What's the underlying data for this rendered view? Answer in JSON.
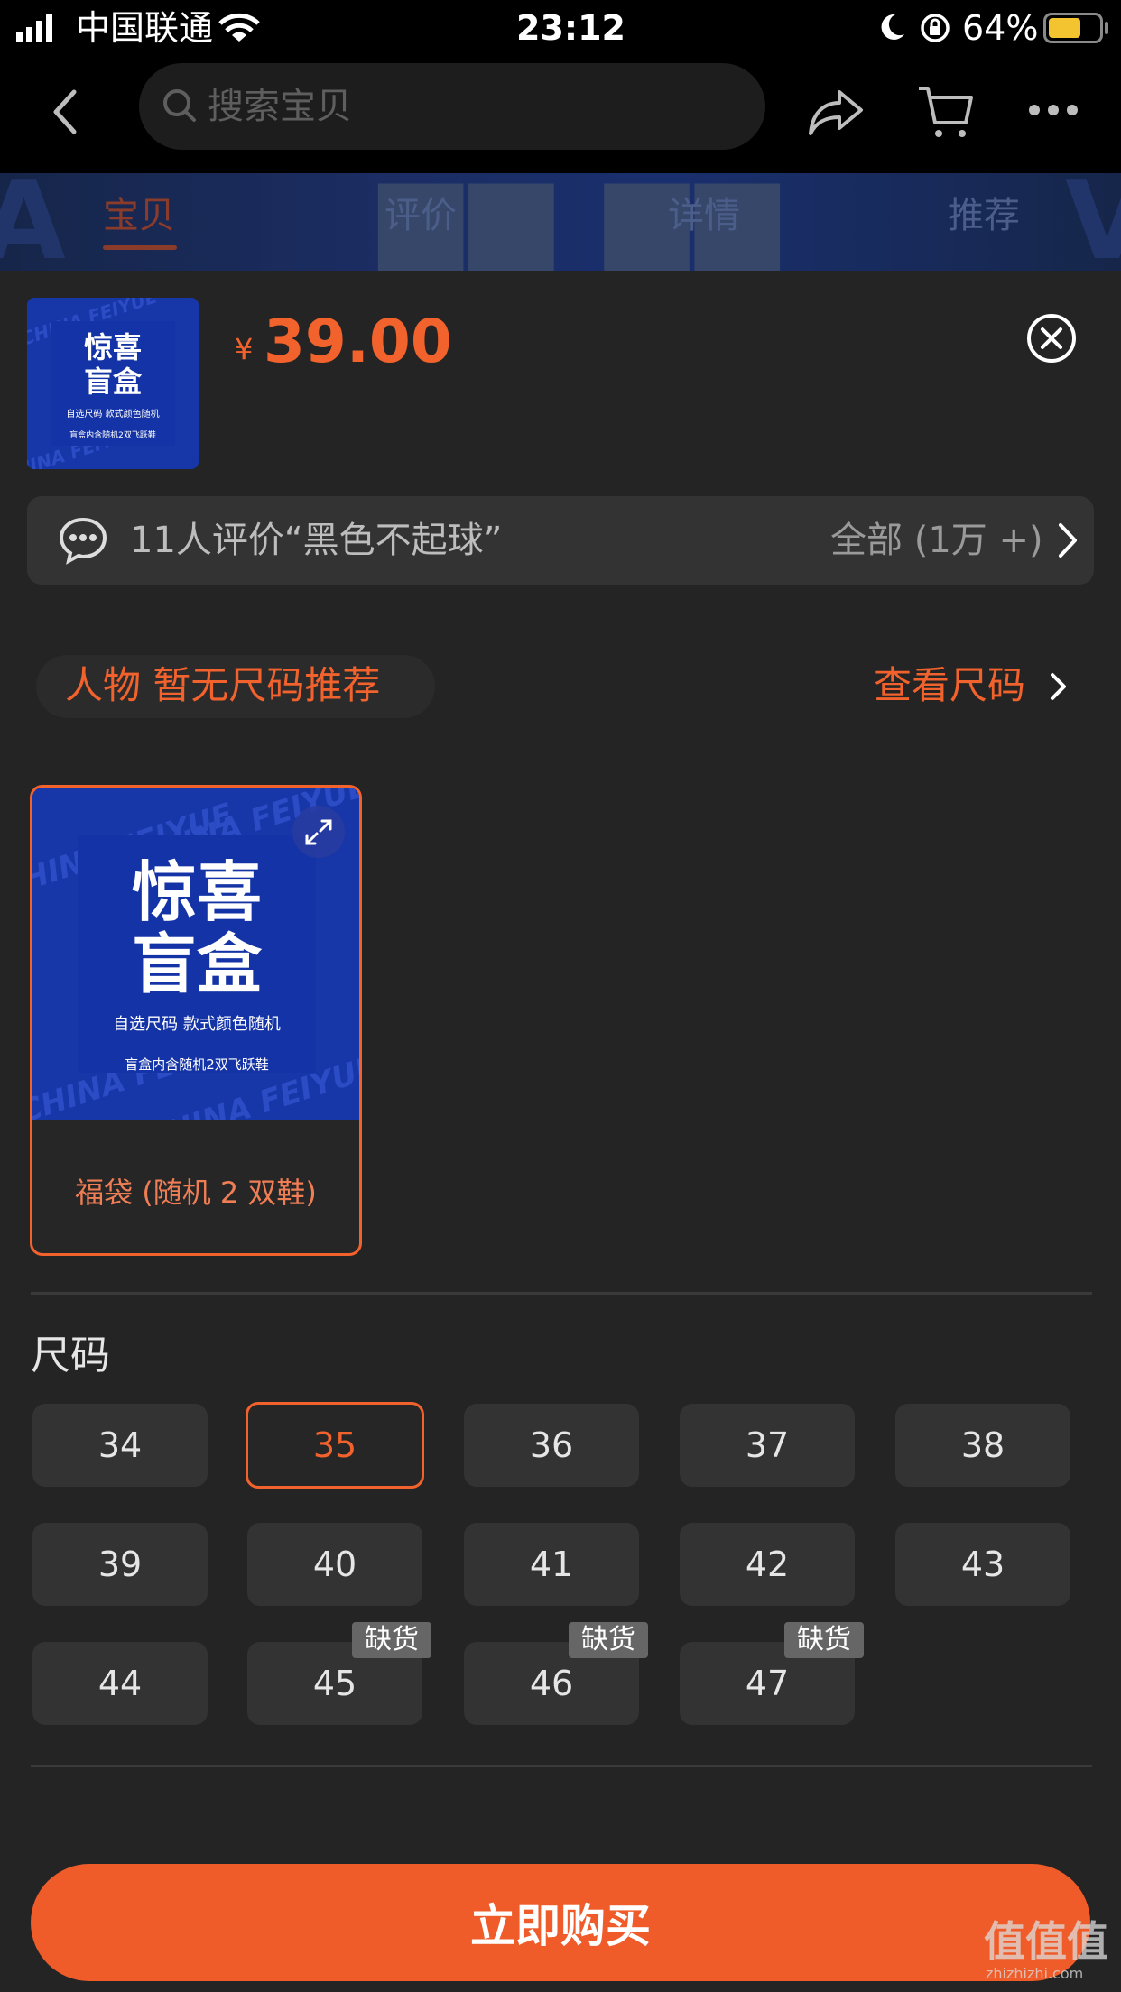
{
  "status_bar": {
    "carrier": "中国联通",
    "time": "23:12",
    "battery": "64%",
    "battery_level": 0.64,
    "icons": [
      "signal-icon",
      "wifi-icon",
      "moon-icon",
      "orientation-lock-icon",
      "battery-icon"
    ]
  },
  "nav": {
    "search_placeholder": "搜索宝贝",
    "icons": [
      "back-icon",
      "search-icon",
      "share-icon",
      "cart-icon",
      "more-icon"
    ]
  },
  "tabs": [
    {
      "label": "宝贝",
      "active": true
    },
    {
      "label": "评价",
      "active": false
    },
    {
      "label": "详情",
      "active": false
    },
    {
      "label": "推荐",
      "active": false
    }
  ],
  "product": {
    "currency": "¥",
    "price": "39.00",
    "art_title_line1": "惊喜",
    "art_title_line2": "盲盒",
    "art_subtitle": "自选尺码  款式颜色随机",
    "art_note": "盲盒内含随机2双飞跃鞋",
    "art_bg_text": "CHINA FEIYUE"
  },
  "review_bar": {
    "text": "11人评价“黑色不起球”",
    "all_label": "全部 (1万 +)"
  },
  "size_recommend": {
    "text": "人物 暂无尺码推荐",
    "link": "查看尺码"
  },
  "variant": {
    "label": "福袋 (随机 2 双鞋)",
    "selected": true
  },
  "sizes": {
    "title": "尺码",
    "items": [
      {
        "label": "34",
        "out_of_stock": false
      },
      {
        "label": "35",
        "out_of_stock": false,
        "selected": true
      },
      {
        "label": "36",
        "out_of_stock": false
      },
      {
        "label": "37",
        "out_of_stock": false
      },
      {
        "label": "38",
        "out_of_stock": false
      },
      {
        "label": "39",
        "out_of_stock": false
      },
      {
        "label": "40",
        "out_of_stock": false
      },
      {
        "label": "41",
        "out_of_stock": false
      },
      {
        "label": "42",
        "out_of_stock": false
      },
      {
        "label": "43",
        "out_of_stock": false
      },
      {
        "label": "44",
        "out_of_stock": false
      },
      {
        "label": "45",
        "out_of_stock": true
      },
      {
        "label": "46",
        "out_of_stock": true
      },
      {
        "label": "47",
        "out_of_stock": true
      }
    ],
    "out_of_stock_label": "缺货"
  },
  "buy_button": {
    "label": "立即购买"
  },
  "watermark": {
    "main": "值值值",
    "sub": "zhizhizhi.com"
  },
  "colors": {
    "accent": "#f2622c",
    "sheet_bg": "#242424",
    "art_blue": "#1736a8"
  }
}
